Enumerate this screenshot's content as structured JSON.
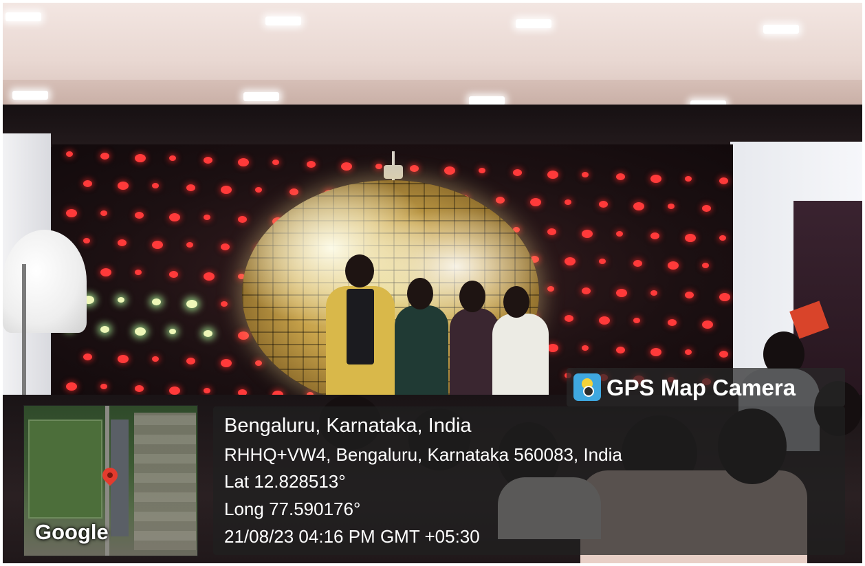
{
  "overlay": {
    "brand": {
      "icon": "gps-map-camera-icon",
      "text": "GPS Map Camera"
    },
    "map": {
      "logo": "Google",
      "pin_icon": "location-pin-icon"
    },
    "location": {
      "title": "Bengaluru, Karnataka, India",
      "address": "RHHQ+VW4, Bengaluru, Karnataka 560083, India",
      "lat": "Lat 12.828513°",
      "long": "Long 77.590176°",
      "datetime": "21/08/23 04:16 PM GMT +05:30"
    }
  },
  "colors": {
    "overlay_bg": "#202020",
    "stage_dot": "#ff3a3a",
    "pin": "#e33b2e",
    "brand_icon": "#3fa8e0"
  }
}
